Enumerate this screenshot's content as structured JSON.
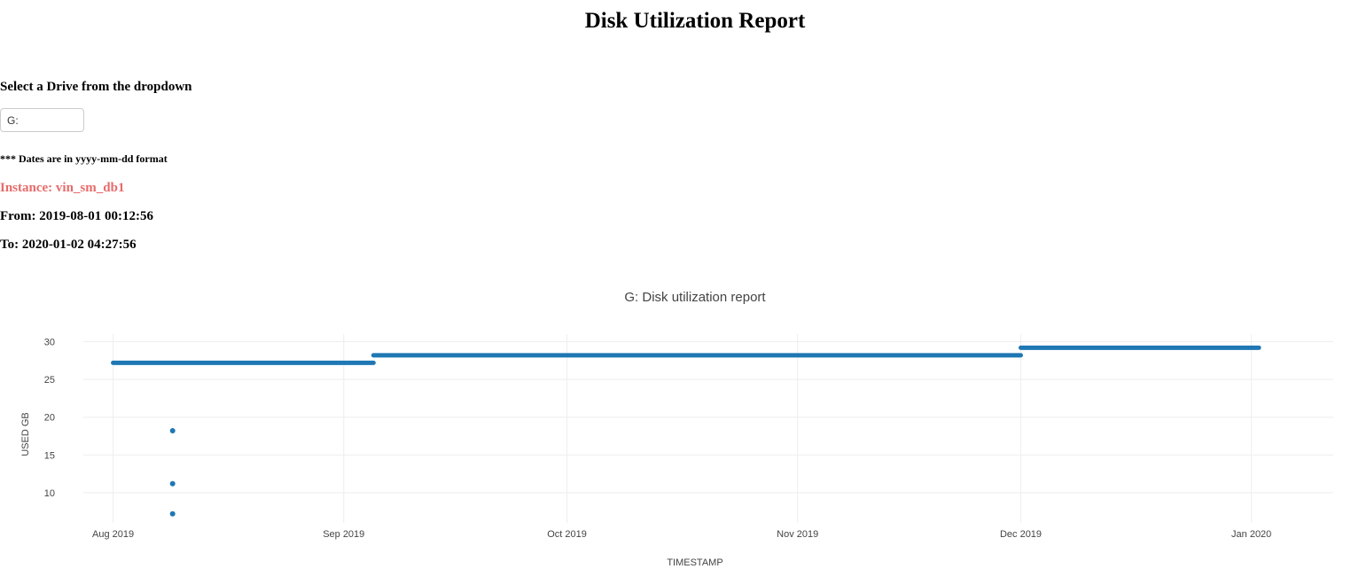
{
  "page": {
    "title": "Disk Utilization Report",
    "drive_prompt": "Select a Drive from the dropdown",
    "drive_selected": "G:",
    "date_note": "*** Dates are in yyyy-mm-dd format",
    "instance_label": "Instance:",
    "instance_value": "vin_sm_db1",
    "from_label": "From:",
    "from_value": "2019-08-01 00:12:56",
    "to_label": "To:",
    "to_value": "2020-01-02 04:27:56"
  },
  "colors": {
    "series": "#1f77b4",
    "instance": "#e86b6b",
    "grid": "#eeeeee"
  },
  "chart_data": {
    "type": "scatter",
    "title": "G: Disk utilization report",
    "xlabel": "TIMESTAMP",
    "ylabel": "USED GB",
    "xlim": [
      "2019-07-28",
      "2020-01-12"
    ],
    "ylim": [
      6,
      31
    ],
    "grid": true,
    "x_ticks": [
      "2019-08-01",
      "2019-09-01",
      "2019-10-01",
      "2019-11-01",
      "2019-12-01",
      "2020-01-01"
    ],
    "x_tick_labels": [
      "Aug 2019",
      "Sep 2019",
      "Oct 2019",
      "Nov 2019",
      "Dec 2019",
      "Jan 2020"
    ],
    "y_ticks": [
      10,
      15,
      20,
      25,
      30
    ],
    "series": [
      {
        "segments": [
          {
            "from": "2019-08-01",
            "to": "2019-09-05",
            "value": 27.2
          },
          {
            "from": "2019-09-05",
            "to": "2019-12-01",
            "value": 28.2
          },
          {
            "from": "2019-12-01",
            "to": "2020-01-02",
            "value": 29.2
          }
        ],
        "points": [
          {
            "x": "2019-08-09",
            "y": 18.2
          },
          {
            "x": "2019-08-09",
            "y": 11.2
          },
          {
            "x": "2019-08-09",
            "y": 7.2
          }
        ]
      }
    ]
  }
}
